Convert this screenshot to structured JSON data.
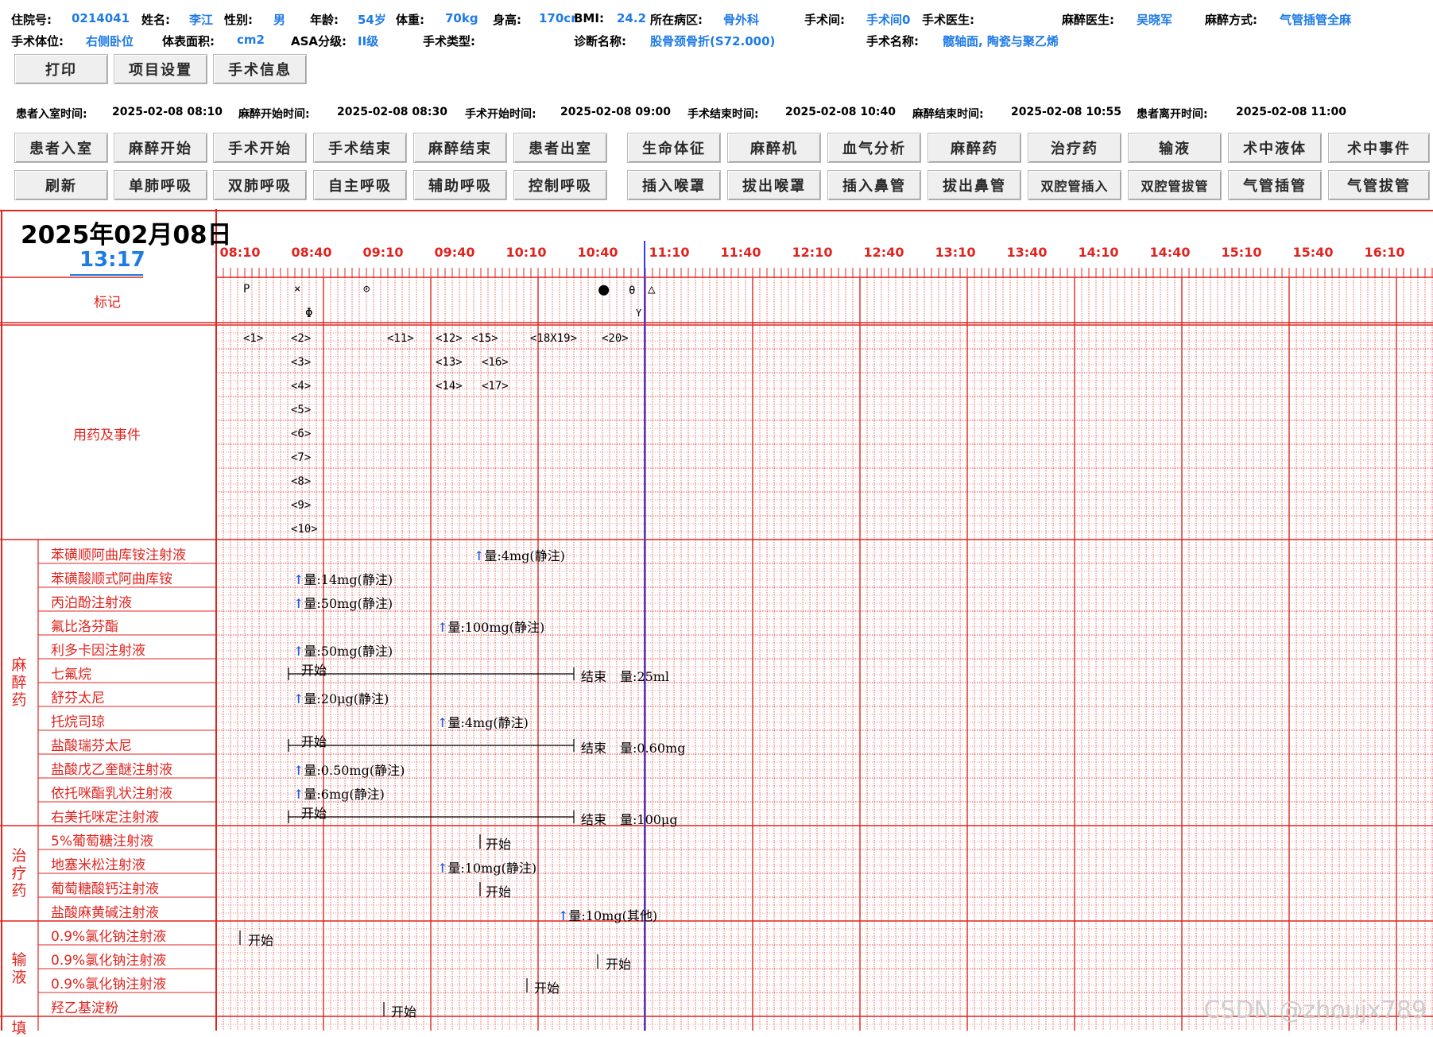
{
  "patient": {
    "row1": [
      {
        "label": "住院号:",
        "value": "0214041"
      },
      {
        "label": "姓名:",
        "value": "李江"
      },
      {
        "label": "性别:",
        "value": "男"
      },
      {
        "label": "年龄:",
        "value": "54岁"
      },
      {
        "label": "体重:",
        "value": "70kg"
      },
      {
        "label": "身高:",
        "value": "170cr"
      },
      {
        "label": "BMI:",
        "value": "24.2"
      },
      {
        "label": "所在病区:",
        "value": "骨外科"
      },
      {
        "label": "手术间:",
        "value": "手术间0"
      },
      {
        "label": "手术医生:",
        "value": ""
      },
      {
        "label": "麻醉医生:",
        "value": "吴晓军"
      },
      {
        "label": "麻醉方式:",
        "value": "气管插管全麻"
      }
    ],
    "row2": [
      {
        "label": "手术体位:",
        "value": "右侧卧位"
      },
      {
        "label": "体表面积:",
        "value": "cm2"
      },
      {
        "label": "ASA分级:",
        "value": "II级"
      },
      {
        "label": "手术类型:",
        "value": ""
      },
      {
        "label": "诊断名称:",
        "value": "股骨颈骨折(S72.000)"
      },
      {
        "label": "手术名称:",
        "value": "髋轴面, 陶瓷与聚乙烯"
      }
    ]
  },
  "top_buttons": [
    "打印",
    "项目设置",
    "手术信息"
  ],
  "times": [
    {
      "label": "患者入室时间:",
      "value": "2025-02-08 08:10"
    },
    {
      "label": "麻醉开始时间:",
      "value": "2025-02-08 08:30"
    },
    {
      "label": "手术开始时间:",
      "value": "2025-02-08 09:00"
    },
    {
      "label": "手术结束时间:",
      "value": "2025-02-08 10:40"
    },
    {
      "label": "麻醉结束时间:",
      "value": "2025-02-08 10:55"
    },
    {
      "label": "患者离开时间:",
      "value": "2025-02-08 11:00"
    }
  ],
  "button_row1": [
    "患者入室",
    "麻醉开始",
    "手术开始",
    "手术结束",
    "麻醉结束",
    "患者出室",
    "生命体征",
    "麻醉机",
    "血气分析",
    "麻醉药",
    "治疗药",
    "输液",
    "术中液体",
    "术中事件"
  ],
  "button_row2": [
    "刷新",
    "单肺呼吸",
    "双肺呼吸",
    "自主呼吸",
    "辅助呼吸",
    "控制呼吸",
    "插入喉罩",
    "拔出喉罩",
    "插入鼻管",
    "拔出鼻管",
    "双腔管插入",
    "双腔管拔管",
    "气管插管",
    "气管拔管"
  ],
  "chart": {
    "date": "2025年02月08日",
    "clock": "13:17",
    "ticks": [
      "08:10",
      "08:40",
      "09:10",
      "09:40",
      "10:10",
      "10:40",
      "11:10",
      "11:40",
      "12:10",
      "12:40",
      "13:10",
      "13:40",
      "14:10",
      "14:40",
      "15:10",
      "15:40",
      "16:10"
    ],
    "marker_row_label": "标记",
    "events_row_label": "用药及事件",
    "markers": [
      "P",
      "×",
      "⊙",
      "●",
      "θ",
      "△",
      "Φ",
      "Y"
    ],
    "events": [
      "<1>",
      "<2>",
      "<3>",
      "<4>",
      "<5>",
      "<6>",
      "<7>",
      "<8>",
      "<9>",
      "<10>",
      "<11>",
      "<12>",
      "<13>",
      "<14>",
      "<15>",
      "<16>",
      "<17>",
      "<18X19>",
      "<20>"
    ],
    "categories": [
      {
        "name": "麻醉药",
        "items": [
          "苯磺顺阿曲库铵注射液",
          "苯磺酸顺式阿曲库铵",
          "丙泊酚注射液",
          "氟比洛芬酯",
          "利多卡因注射液",
          "七氟烷",
          "舒芬太尼",
          "托烷司琼",
          "盐酸瑞芬太尼",
          "盐酸戊乙奎醚注射液",
          "依托咪酯乳状注射液",
          "右美托咪定注射液"
        ]
      },
      {
        "name": "治疗药",
        "items": [
          "5%葡萄糖注射液",
          "地塞米松注射液",
          "葡萄糖酸钙注射液",
          "盐酸麻黄碱注射液"
        ]
      },
      {
        "name": "输液",
        "items": [
          "0.9%氯化钠注射液",
          "0.9%氯化钠注射液",
          "0.9%氯化钠注射液",
          "羟乙基淀粉"
        ]
      },
      {
        "name": "填",
        "items": []
      }
    ],
    "drug_texts": {
      "d0": "量:4mg(静注)",
      "d1": "量:14mg(静注)",
      "d2": "量:50mg(静注)",
      "d3": "量:100mg(静注)",
      "d4": "量:50mg(静注)",
      "d5_start": "开始",
      "d5_end": "结束",
      "d5_amt": "量:25ml",
      "d6": "量:20μg(静注)",
      "d7": "量:4mg(静注)",
      "d8_start": "开始",
      "d8_end": "结束",
      "d8_amt": "量:0.60mg",
      "d9": "量:0.50mg(静注)",
      "d10": "量:6mg(静注)",
      "d11_start": "开始",
      "d11_end": "结束",
      "d11_amt": "量:100μg",
      "t0": "开始",
      "t1": "量:10mg(静注)",
      "t2": "开始",
      "t3": "量:10mg(其他)",
      "f0": "开始",
      "f1": "开始",
      "f2": "开始",
      "f3": "开始"
    }
  },
  "watermark": "CSDN @zhoujx789",
  "colors": {
    "accent_blue": "#1e7be6",
    "grid_red": "#e0241f",
    "now_line": "#3a3ae6"
  }
}
